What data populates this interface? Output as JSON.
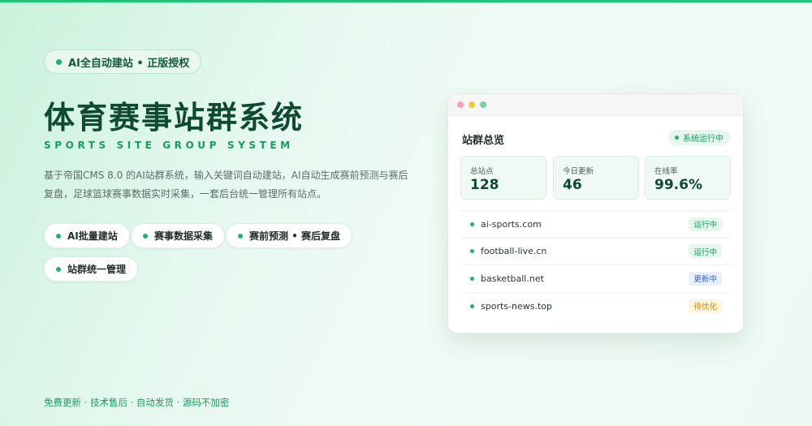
{
  "badge": {
    "text": "AI全自动建站 • 正版授权"
  },
  "hero": {
    "title": "体育赛事站群系统",
    "subtitle": "SPORTS SITE GROUP SYSTEM",
    "description": "基于帝国CMS 8.0 的AI站群系统，输入关键词自动建站，AI自动生成赛前预测与赛后复盘，足球篮球赛事数据实时采集，一套后台统一管理所有站点。"
  },
  "features": [
    {
      "label": "AI批量建站"
    },
    {
      "label": "赛事数据采集"
    },
    {
      "label": "赛前预测 • 赛后复盘"
    },
    {
      "label": "站群统一管理"
    }
  ],
  "footer_note": "免费更新 · 技术售后 · 自动发货 · 源码不加密",
  "dashboard": {
    "title": "站群总览",
    "status": "系统运行中",
    "stats": [
      {
        "label": "总站点",
        "value": "128"
      },
      {
        "label": "今日更新",
        "value": "46"
      },
      {
        "label": "在线率",
        "value": "99.6%"
      }
    ],
    "sites": [
      {
        "domain": "ai-sports.com",
        "tag": "运行中",
        "tag_color": "#1a9b5c",
        "tag_bg": "#e6f8ee"
      },
      {
        "domain": "football-live.cn",
        "tag": "运行中",
        "tag_color": "#1a9b5c",
        "tag_bg": "#e6f8ee"
      },
      {
        "domain": "basketball.net",
        "tag": "更新中",
        "tag_color": "#3366cc",
        "tag_bg": "#e8efff"
      },
      {
        "domain": "sports-news.top",
        "tag": "待优化",
        "tag_color": "#c98a10",
        "tag_bg": "#fff4dc"
      }
    ],
    "window_dots": [
      "#f7a0b2",
      "#f5c842",
      "#6fd3a6"
    ]
  },
  "colors": {
    "accent": "#1cb56c",
    "title": "#0e4a2f",
    "top_bar": "#22c07a"
  }
}
